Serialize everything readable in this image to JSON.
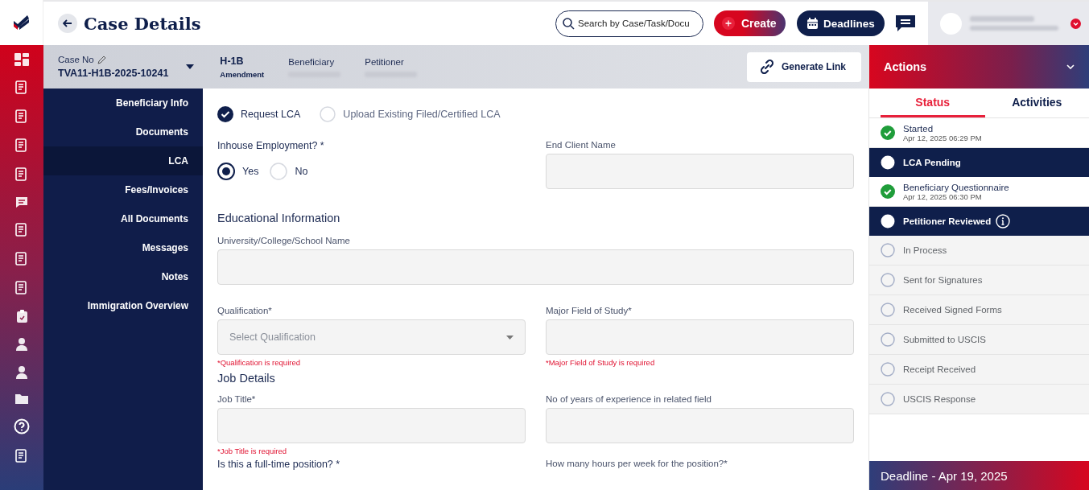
{
  "header": {
    "title": "Case Details",
    "search": {
      "placeholder": "Search by Case/Task/Docu"
    },
    "create_button": "Create",
    "deadlines_button": "Deadlines"
  },
  "case": {
    "case_no_label": "Case No",
    "case_no": "TVA11-H1B-2025-10241",
    "visa_type": "H-1B",
    "visa_subtype": "Amendment",
    "beneficiary_label": "Beneficiary",
    "petitioner_label": "Petitioner",
    "generate_link": "Generate Link"
  },
  "nav": {
    "items": [
      {
        "label": "Beneficiary Info",
        "selected": false
      },
      {
        "label": "Documents",
        "selected": false
      },
      {
        "label": "LCA",
        "selected": true
      },
      {
        "label": "Fees/Invoices",
        "selected": false
      },
      {
        "label": "All Documents",
        "selected": false
      },
      {
        "label": "Messages",
        "selected": false
      },
      {
        "label": "Notes",
        "selected": false
      },
      {
        "label": "Immigration Overview",
        "selected": false
      }
    ]
  },
  "form": {
    "lca_options": [
      {
        "label": "Request LCA",
        "selected": true
      },
      {
        "label": "Upload Existing Filed/Certified LCA",
        "selected": false
      }
    ],
    "inhouse": {
      "label": "Inhouse Employment? *",
      "options": [
        {
          "label": "Yes",
          "selected": true
        },
        {
          "label": "No",
          "selected": false
        }
      ]
    },
    "end_client": {
      "label": "End Client Name"
    },
    "education": {
      "heading": "Educational Information",
      "university": {
        "label": "University/College/School Name"
      },
      "qualification": {
        "label": "Qualification*",
        "placeholder": "Select Qualification",
        "error": "*Qualification is required"
      },
      "major": {
        "label": "Major Field of Study*",
        "error": "*Major Field of Study is required"
      }
    },
    "job": {
      "heading": "Job Details",
      "title": {
        "label": "Job Title*",
        "error": "*Job Title is required"
      },
      "experience": {
        "label": "No of years of experience in related field"
      },
      "full_time": {
        "label": "Is this a full-time position? *"
      },
      "hours": {
        "label": "How many hours per week for the position?*"
      }
    }
  },
  "actions": {
    "title": "Actions",
    "tabs": [
      {
        "label": "Status",
        "selected": true
      },
      {
        "label": "Activities",
        "selected": false
      }
    ],
    "statuses": [
      {
        "label": "Started",
        "date": "Apr 12, 2025 06:29 PM",
        "kind": "done",
        "info": false
      },
      {
        "label": "LCA Pending",
        "kind": "active",
        "info": false
      },
      {
        "label": "Beneficiary Questionnaire",
        "date": "Apr 12, 2025 06:30 PM",
        "kind": "done",
        "info": false
      },
      {
        "label": "Petitioner Reviewed",
        "kind": "active",
        "info": true
      },
      {
        "label": "In Process",
        "kind": "pending",
        "info": false
      },
      {
        "label": "Sent for Signatures",
        "kind": "pending",
        "info": false
      },
      {
        "label": "Received Signed Forms",
        "kind": "pending",
        "info": false
      },
      {
        "label": "Submitted to USCIS",
        "kind": "pending",
        "info": false
      },
      {
        "label": "Receipt Received",
        "kind": "pending",
        "info": false
      },
      {
        "label": "USCIS Response",
        "kind": "pending",
        "info": false
      }
    ],
    "deadline": "Deadline - Apr 19, 2025"
  }
}
